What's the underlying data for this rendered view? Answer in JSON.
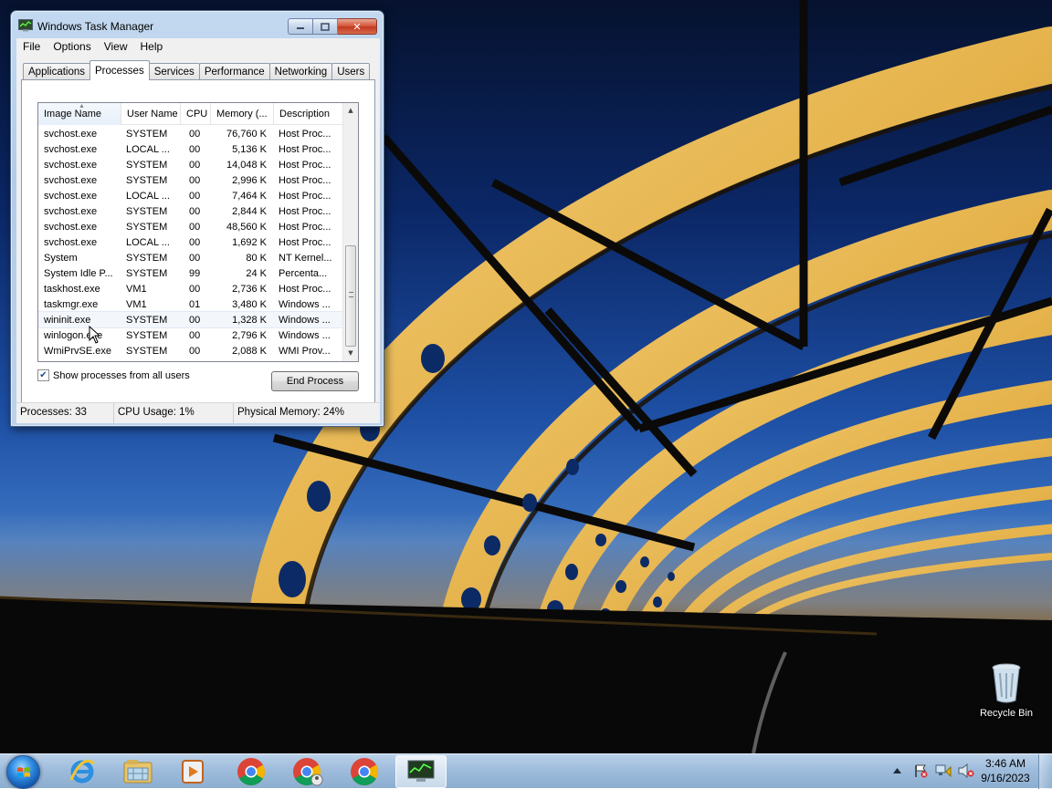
{
  "window": {
    "title": "Windows Task Manager",
    "buttons": {
      "close": "✕"
    },
    "menu": [
      "File",
      "Options",
      "View",
      "Help"
    ],
    "tabs": [
      "Applications",
      "Processes",
      "Services",
      "Performance",
      "Networking",
      "Users"
    ],
    "active_tab": "Processes"
  },
  "processes": {
    "columns": [
      "Image Name",
      "User Name",
      "CPU",
      "Memory (...",
      "Description"
    ],
    "sorted_column": "Image Name",
    "rows": [
      [
        "svchost.exe",
        "SYSTEM",
        "00",
        "76,760 K",
        "Host Proc..."
      ],
      [
        "svchost.exe",
        "LOCAL ...",
        "00",
        "5,136 K",
        "Host Proc..."
      ],
      [
        "svchost.exe",
        "SYSTEM",
        "00",
        "14,048 K",
        "Host Proc..."
      ],
      [
        "svchost.exe",
        "SYSTEM",
        "00",
        "2,996 K",
        "Host Proc..."
      ],
      [
        "svchost.exe",
        "LOCAL ...",
        "00",
        "7,464 K",
        "Host Proc..."
      ],
      [
        "svchost.exe",
        "SYSTEM",
        "00",
        "2,844 K",
        "Host Proc..."
      ],
      [
        "svchost.exe",
        "SYSTEM",
        "00",
        "48,560 K",
        "Host Proc..."
      ],
      [
        "svchost.exe",
        "LOCAL ...",
        "00",
        "1,692 K",
        "Host Proc..."
      ],
      [
        "System",
        "SYSTEM",
        "00",
        "80 K",
        "NT Kernel..."
      ],
      [
        "System Idle P...",
        "SYSTEM",
        "99",
        "24 K",
        "Percenta..."
      ],
      [
        "taskhost.exe",
        "VM1",
        "00",
        "2,736 K",
        "Host Proc..."
      ],
      [
        "taskmgr.exe",
        "VM1",
        "01",
        "3,480 K",
        "Windows ..."
      ],
      [
        "wininit.exe",
        "SYSTEM",
        "00",
        "1,328 K",
        "Windows ..."
      ],
      [
        "winlogon.exe",
        "SYSTEM",
        "00",
        "2,796 K",
        "Windows ..."
      ],
      [
        "WmiPrvSE.exe",
        "SYSTEM",
        "00",
        "2,088 K",
        "WMI Prov..."
      ]
    ],
    "hovered_row": "wininit.exe",
    "show_all_label": "Show processes from all users",
    "show_all_checked": true,
    "end_process_label": "End Process"
  },
  "status": {
    "processes": "Processes: 33",
    "cpu": "CPU Usage: 1%",
    "memory": "Physical Memory: 24%"
  },
  "desktop": {
    "recycle_bin_label": "Recycle Bin"
  },
  "taskbar": {
    "pinned": [
      "start-orb",
      "internet-explorer-icon",
      "windows-explorer-icon",
      "media-player-icon",
      "chrome-icon",
      "chrome-user-icon",
      "chrome-icon",
      "task-manager-icon"
    ],
    "active": "task-manager-icon",
    "tray_icons": [
      "show-hidden-icons-arrow",
      "action-center-icon",
      "network-icon",
      "volume-muted-icon"
    ],
    "time": "3:46 AM",
    "date": "9/16/2023"
  },
  "colors": {
    "titlebar": "#b9d1ea",
    "close_button": "#c7432a",
    "selection_accent": "#1d4f8a",
    "taskbar": "#9fbcdc"
  }
}
